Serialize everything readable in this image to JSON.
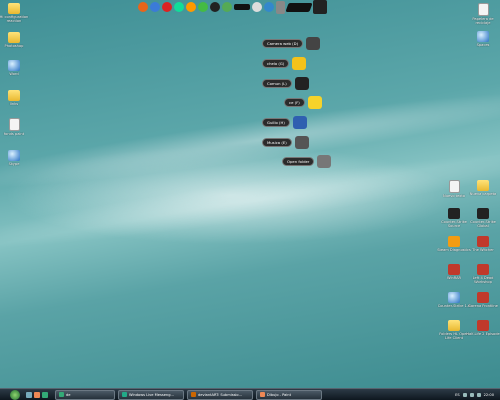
{
  "desktop_left": [
    {
      "label": "Hi configuration reaction",
      "kind": "folder"
    },
    {
      "label": "Photoshop",
      "kind": "folder"
    },
    {
      "label": "Word",
      "kind": "blue"
    },
    {
      "label": "links",
      "kind": "folder"
    },
    {
      "label": "fonds paint",
      "kind": "doc"
    },
    {
      "label": "Skype",
      "kind": "blue"
    }
  ],
  "desktop_right_top": [
    {
      "label": "Papelera de reciclaje",
      "kind": "doc"
    },
    {
      "label": "Spaces",
      "kind": "blue"
    }
  ],
  "desktop_right_grid": [
    {
      "label": "Nuevo texto",
      "kind": "doc"
    },
    {
      "label": "Nueva carpeta",
      "kind": "folder"
    },
    {
      "label": "Counter-Strike Source",
      "kind": "black"
    },
    {
      "label": "Counter-Strike Global",
      "kind": "black"
    },
    {
      "label": "Steam Diagnostics",
      "kind": "orange"
    },
    {
      "label": "The Witcher",
      "kind": "red"
    },
    {
      "label": "WinRAR",
      "kind": "red"
    },
    {
      "label": "Left 4 Dead Workshop",
      "kind": "red"
    },
    {
      "label": "Counter-Strike 1.6",
      "kind": "blue"
    },
    {
      "label": "Garena Frontline",
      "kind": "red"
    },
    {
      "label": "Folders HL Open Life Client",
      "kind": "folder"
    },
    {
      "label": "Half-Life 2 Episode",
      "kind": "red"
    }
  ],
  "dock_icons": [
    "firefox-icon",
    "chrome-icon",
    "opera-icon",
    "flashget-icon",
    "winamp-icon",
    "utorrent-icon",
    "app-icon",
    "app-icon",
    "drive-icon",
    "skull-icon",
    "media-icon",
    "trash-icon",
    "hdd-icon",
    "laptop-icon"
  ],
  "shortcuts": [
    {
      "label": "Camera web (D)",
      "color": "#444"
    },
    {
      "label": "chelo (G)",
      "color": "#f4c21a"
    },
    {
      "label": "Comun (L)",
      "color": "#222"
    },
    {
      "label": "ce (F)",
      "color": "#f6d32a"
    },
    {
      "label": "Guillo (H)",
      "color": "#2f5fb0"
    },
    {
      "label": "Musica (E)",
      "color": "#555"
    },
    {
      "label": "Open folder",
      "color": "#777"
    }
  ],
  "taskbar": {
    "tasks": [
      {
        "label": "de",
        "color": "#3a7"
      },
      {
        "label": "Windows Live Messeng...",
        "color": "#2a8"
      },
      {
        "label": "deviantART: Submissio...",
        "color": "#c60"
      },
      {
        "label": "Dibujo - Paint",
        "color": "#e85"
      }
    ],
    "language": "ES",
    "clock": "22:00"
  }
}
